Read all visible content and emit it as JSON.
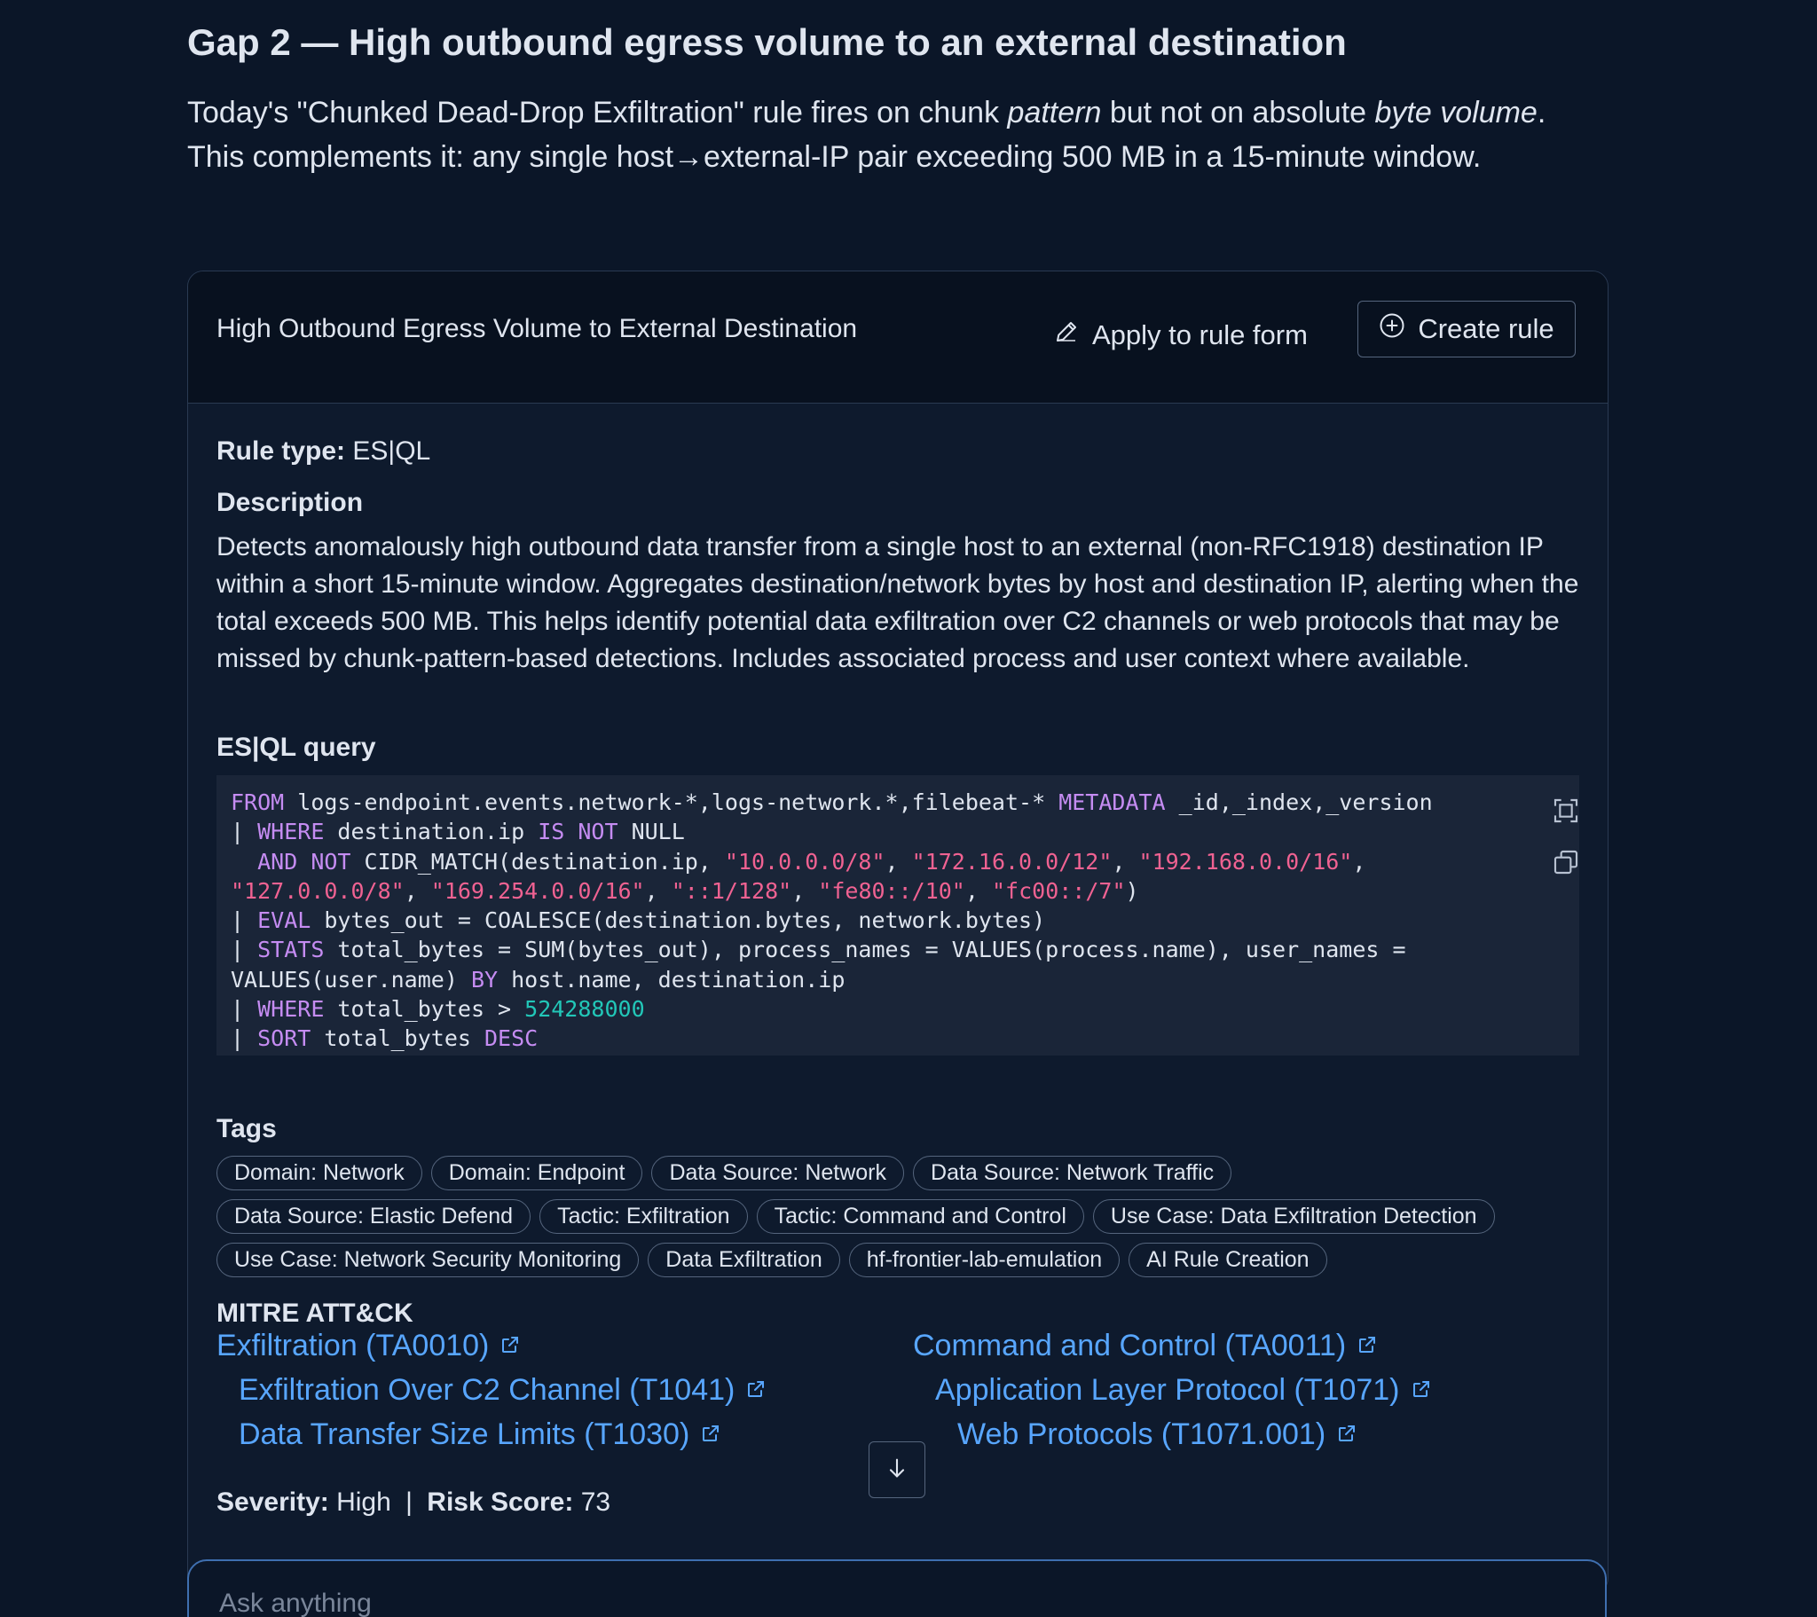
{
  "gap": {
    "heading": "Gap 2 — High outbound egress volume to an external destination",
    "intro_1": "Today's \"Chunked Dead-Drop Exfiltration\" rule fires on chunk ",
    "intro_em1": "pattern",
    "intro_2": " but not on absolute ",
    "intro_em2": "byte volume",
    "intro_3": ". This complements it: any single host→external-IP pair exceeding 500 MB in a 15-minute window."
  },
  "card": {
    "title": "High Outbound Egress Volume to External Destination",
    "apply_label": "Apply to rule form",
    "create_label": "Create rule",
    "rule_type_label": "Rule type:",
    "rule_type_value": "ES|QL",
    "description_title": "Description",
    "description": "Detects anomalously high outbound data transfer from a single host to an external (non-RFC1918) destination IP within a short 15-minute window. Aggregates destination/network bytes by host and destination IP, alerting when the total exceeds 500 MB. This helps identify potential data exfiltration over C2 channels or web protocols that may be missed by chunk-pattern-based detections. Includes associated process and user context where available.",
    "query_title": "ES|QL query",
    "query_lines": [
      [
        {
          "t": "FROM",
          "c": "kw"
        },
        {
          "t": " logs-endpoint.events.network-*,logs-network.*,filebeat-* ",
          "c": ""
        },
        {
          "t": "METADATA",
          "c": "kw"
        },
        {
          "t": " _id,_index,_version",
          "c": ""
        }
      ],
      [
        {
          "t": "| ",
          "c": ""
        },
        {
          "t": "WHERE",
          "c": "kw"
        },
        {
          "t": " destination.ip ",
          "c": ""
        },
        {
          "t": "IS NOT",
          "c": "kw"
        },
        {
          "t": " NULL",
          "c": ""
        }
      ],
      [
        {
          "t": "  ",
          "c": ""
        },
        {
          "t": "AND NOT",
          "c": "kw"
        },
        {
          "t": " CIDR_MATCH(destination.ip, ",
          "c": ""
        },
        {
          "t": "\"10.0.0.0/8\"",
          "c": "str"
        },
        {
          "t": ", ",
          "c": ""
        },
        {
          "t": "\"172.16.0.0/12\"",
          "c": "str"
        },
        {
          "t": ", ",
          "c": ""
        },
        {
          "t": "\"192.168.0.0/16\"",
          "c": "str"
        },
        {
          "t": ",",
          "c": ""
        }
      ],
      [
        {
          "t": "\"127.0.0.0/8\"",
          "c": "str"
        },
        {
          "t": ", ",
          "c": ""
        },
        {
          "t": "\"169.254.0.0/16\"",
          "c": "str"
        },
        {
          "t": ", ",
          "c": ""
        },
        {
          "t": "\"::1/128\"",
          "c": "str"
        },
        {
          "t": ", ",
          "c": ""
        },
        {
          "t": "\"fe80::/10\"",
          "c": "str"
        },
        {
          "t": ", ",
          "c": ""
        },
        {
          "t": "\"fc00::/7\"",
          "c": "str"
        },
        {
          "t": ")",
          "c": ""
        }
      ],
      [
        {
          "t": "| ",
          "c": ""
        },
        {
          "t": "EVAL",
          "c": "kw"
        },
        {
          "t": " bytes_out = COALESCE(destination.bytes, network.bytes)",
          "c": ""
        }
      ],
      [
        {
          "t": "| ",
          "c": ""
        },
        {
          "t": "STATS",
          "c": "kw"
        },
        {
          "t": " total_bytes = SUM(bytes_out), process_names = VALUES(process.name), user_names =",
          "c": ""
        }
      ],
      [
        {
          "t": "VALUES(user.name) ",
          "c": ""
        },
        {
          "t": "BY",
          "c": "kw"
        },
        {
          "t": " host.name, destination.ip",
          "c": ""
        }
      ],
      [
        {
          "t": "| ",
          "c": ""
        },
        {
          "t": "WHERE",
          "c": "kw"
        },
        {
          "t": " total_bytes > ",
          "c": ""
        },
        {
          "t": "524288000",
          "c": "num"
        }
      ],
      [
        {
          "t": "| ",
          "c": ""
        },
        {
          "t": "SORT",
          "c": "kw"
        },
        {
          "t": " total_bytes ",
          "c": ""
        },
        {
          "t": "DESC",
          "c": "kw"
        }
      ]
    ],
    "tags_title": "Tags",
    "tag_rows": [
      [
        "Domain: Network",
        "Domain: Endpoint",
        "Data Source: Network",
        "Data Source: Network Traffic"
      ],
      [
        "Data Source: Elastic Defend",
        "Tactic: Exfiltration",
        "Tactic: Command and Control",
        "Use Case: Data Exfiltration Detection"
      ],
      [
        "Use Case: Network Security Monitoring",
        "Data Exfiltration",
        "hf-frontier-lab-emulation",
        "AI Rule Creation"
      ]
    ],
    "mitre_title": "MITRE ATT&CK",
    "mitre": {
      "tactic1": "Exfiltration (TA0010)",
      "tech1a": "Exfiltration Over C2 Channel (T1041)",
      "tech1b": "Data Transfer Size Limits (T1030)",
      "tactic2": "Command and Control (TA0011)",
      "tech2a": "Application Layer Protocol (T1071)",
      "tech2b": "Web Protocols (T1071.001)"
    },
    "severity_label": "Severity:",
    "severity_value": "High",
    "risk_label": "Risk Score:",
    "risk_value": "73"
  },
  "ask": {
    "placeholder": "Ask anything"
  },
  "icons": {
    "apply": "pencil-icon",
    "create": "plus-circle-icon",
    "fullscreen": "fullscreen-icon",
    "copy": "copy-icon",
    "external": "external-link-icon",
    "scroll": "arrow-down-icon"
  },
  "colors": {
    "background": "#0b1628",
    "link": "#58a6ff",
    "keyword": "#c58cf2",
    "string": "#f06292",
    "number": "#22c7b8"
  }
}
